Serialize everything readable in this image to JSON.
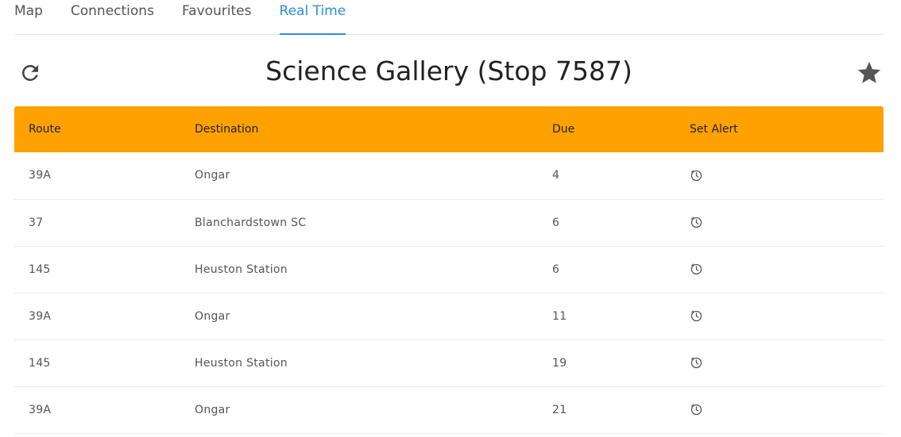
{
  "tabs": [
    {
      "label": "Map",
      "active": false
    },
    {
      "label": "Connections",
      "active": false
    },
    {
      "label": "Favourites",
      "active": false
    },
    {
      "label": "Real Time",
      "active": true
    }
  ],
  "header": {
    "title": "Science Gallery (Stop 7587)",
    "refresh_icon": "refresh-icon",
    "favourite_icon": "star-icon"
  },
  "table": {
    "columns": [
      "Route",
      "Destination",
      "Due",
      "Set Alert"
    ],
    "rows": [
      {
        "route": "39A",
        "destination": "Ongar",
        "due": "4"
      },
      {
        "route": "37",
        "destination": "Blanchardstown SC",
        "due": "6"
      },
      {
        "route": "145",
        "destination": "Heuston Station",
        "due": "6"
      },
      {
        "route": "39A",
        "destination": "Ongar",
        "due": "11"
      },
      {
        "route": "145",
        "destination": "Heuston Station",
        "due": "19"
      },
      {
        "route": "39A",
        "destination": "Ongar",
        "due": "21"
      }
    ]
  },
  "colors": {
    "accent": "#2f8be0",
    "header_bg": "#ffa100"
  }
}
